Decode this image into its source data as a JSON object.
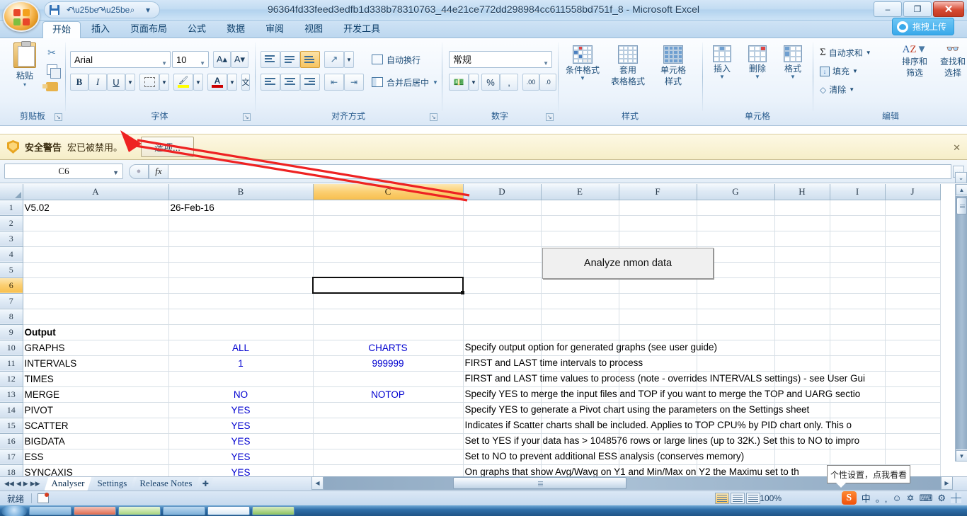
{
  "window": {
    "title": "96364fd33feed3edfb1d338b78310763_44e21ce772dd298984cc611558bd751f_8 - Microsoft Excel",
    "minimize_label": "–",
    "maximize_label": "❐",
    "close_label": "✕"
  },
  "quick_access": {
    "save": "save-icon",
    "undo": "↶",
    "redo": "↷",
    "print_preview": "⌕",
    "customize": "▾"
  },
  "upload_button": {
    "label": "拖拽上传"
  },
  "ribbon": {
    "tabs": [
      {
        "label": "开始",
        "active": true
      },
      {
        "label": "插入",
        "active": false
      },
      {
        "label": "页面布局",
        "active": false
      },
      {
        "label": "公式",
        "active": false
      },
      {
        "label": "数据",
        "active": false
      },
      {
        "label": "审阅",
        "active": false
      },
      {
        "label": "视图",
        "active": false
      },
      {
        "label": "开发工具",
        "active": false
      }
    ],
    "groups": {
      "clipboard": {
        "name": "剪贴板",
        "paste": "粘贴",
        "paste_arrow": "▾",
        "cut": "✂",
        "copy": "copy-icon",
        "format_painter": "format-painter-icon"
      },
      "font": {
        "name": "字体",
        "font_family": "Arial",
        "font_size": "10",
        "grow_font": "A▴",
        "shrink_font": "A▾",
        "bold": "B",
        "italic": "I",
        "underline": "U",
        "borders": "borders-icon",
        "fill_color": "fill-color-icon",
        "font_color": "A",
        "phonetic": "文",
        "arrow": "▾"
      },
      "alignment": {
        "name": "对齐方式",
        "wrap_text": "自动换行",
        "merge_center": "合并后居中",
        "orientation": "orientation-icon"
      },
      "number": {
        "name": "数字",
        "format": "常规",
        "currency": "currency-icon",
        "percent": "%",
        "comma": ",",
        "inc_decimal": ".00",
        "dec_decimal": ".0"
      },
      "styles": {
        "name": "样式",
        "conditional": "条件格式",
        "table_format_1": "套用",
        "table_format_2": "表格格式",
        "cell_style_1": "单元格",
        "cell_style_2": "样式"
      },
      "cells": {
        "name": "单元格",
        "insert": "插入",
        "delete": "删除",
        "format": "格式"
      },
      "editing": {
        "name": "编辑",
        "autosum": "自动求和",
        "fill": "填充",
        "clear": "清除",
        "sort_filter_1": "排序和",
        "sort_filter_2": "筛选",
        "find_select_1": "查找和",
        "find_select_2": "选择"
      }
    }
  },
  "security_bar": {
    "title": "安全警告",
    "message": "宏已被禁用。",
    "options_button": "选项...",
    "close": "✕"
  },
  "formula_bar": {
    "name_box": "C6",
    "name_box_arrow": "▾",
    "cancel": "✕",
    "enter": "✓",
    "fx": "fx",
    "value": "",
    "expand": "⌄"
  },
  "grid": {
    "columns": [
      "A",
      "B",
      "C",
      "D",
      "E",
      "F",
      "G",
      "H",
      "I",
      "J"
    ],
    "selected_column": "C",
    "selected_row": 6,
    "selected_cell": "C6",
    "rows": [
      {
        "n": 1,
        "A": "V5.02",
        "B": "26-Feb-16",
        "C": "",
        "desc": ""
      },
      {
        "n": 2,
        "A": "",
        "B": "",
        "C": "",
        "desc": ""
      },
      {
        "n": 3,
        "A": "",
        "B": "",
        "C": "",
        "desc": ""
      },
      {
        "n": 4,
        "A": "",
        "B": "",
        "C": "",
        "desc": ""
      },
      {
        "n": 5,
        "A": "",
        "B": "",
        "C": "",
        "desc": ""
      },
      {
        "n": 6,
        "A": "",
        "B": "",
        "C": "",
        "desc": ""
      },
      {
        "n": 7,
        "A": "",
        "B": "",
        "C": "",
        "desc": ""
      },
      {
        "n": 8,
        "A": "",
        "B": "",
        "C": "",
        "desc": ""
      },
      {
        "n": 9,
        "A": "Output",
        "B": "",
        "C": "",
        "desc": ""
      },
      {
        "n": 10,
        "A": "GRAPHS",
        "B": "ALL",
        "C": "CHARTS",
        "desc": "Specify output option for generated graphs (see user guide)"
      },
      {
        "n": 11,
        "A": "INTERVALS",
        "B": "1",
        "C": "999999",
        "desc": "FIRST and LAST time intervals to process"
      },
      {
        "n": 12,
        "A": "TIMES",
        "B": "",
        "C": "",
        "desc": "FIRST and LAST time values to process (note - overrides INTERVALS settings) - see User Gui"
      },
      {
        "n": 13,
        "A": "MERGE",
        "B": "NO",
        "C": "NOTOP",
        "desc": "Specify YES to merge the input files and TOP if you want to merge the TOP and UARG sectio"
      },
      {
        "n": 14,
        "A": "PIVOT",
        "B": "YES",
        "C": "",
        "desc": "Specify YES to generate a Pivot chart using the parameters on the Settings sheet"
      },
      {
        "n": 15,
        "A": "SCATTER",
        "B": "YES",
        "C": "",
        "desc": "Indicates if Scatter charts shall be included.  Applies to TOP CPU% by PID chart only.  This o"
      },
      {
        "n": 16,
        "A": "BIGDATA",
        "B": "YES",
        "C": "",
        "desc": "Set to YES if your data has > 1048576 rows or large lines (up to 32K.)  Set this to NO to impro"
      },
      {
        "n": 17,
        "A": "ESS",
        "B": "YES",
        "C": "",
        "desc": "Set to NO to prevent additional ESS analysis (conserves memory)"
      },
      {
        "n": 18,
        "A": "SYNCAXIS",
        "B": "YES",
        "C": "",
        "desc": "On graphs that show Avg/Wavg on Y1 and Min/Max on Y2 the Maximu            set to th"
      }
    ]
  },
  "shape_button": {
    "label": "Analyze nmon data"
  },
  "sheet_tabs": {
    "first": "◀◀",
    "prev": "◀",
    "next": "▶",
    "last": "▶▶",
    "tabs": [
      {
        "label": "Analyser",
        "active": true
      },
      {
        "label": "Settings",
        "active": false
      },
      {
        "label": "Release Notes",
        "active": false
      }
    ],
    "new_sheet": "➕"
  },
  "status_bar": {
    "ready": "就绪",
    "record_macro": "record-macro-icon",
    "zoom": "100%",
    "view_normal": "normal-view-icon",
    "view_layout": "page-layout-icon",
    "view_break": "page-break-icon"
  },
  "ime": {
    "logo": "S",
    "mode": "中",
    "punct": "。,",
    "smiley": "☺",
    "mic": "✡",
    "keyboard": "⌨",
    "tools": "⚙",
    "skin": "▣"
  },
  "tooltip": {
    "text": "个性设置，点我看看"
  },
  "colors": {
    "accent": "#f8bf4e",
    "blue_text": "#0000d0",
    "ribbon_blue": "#1f4e79",
    "annotation_red": "#ee2222"
  }
}
